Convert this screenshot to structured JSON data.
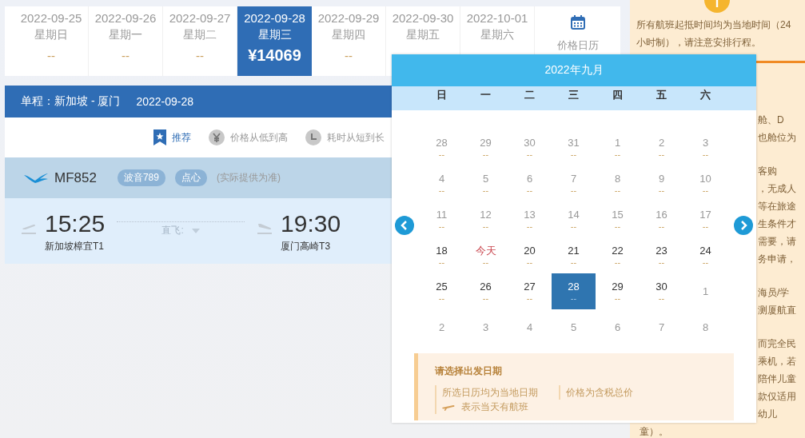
{
  "date_strip": [
    {
      "date": "2022-09-25",
      "weekday": "星期日",
      "price": "--",
      "selected": false
    },
    {
      "date": "2022-09-26",
      "weekday": "星期一",
      "price": "--",
      "selected": false
    },
    {
      "date": "2022-09-27",
      "weekday": "星期二",
      "price": "--",
      "selected": false
    },
    {
      "date": "2022-09-28",
      "weekday": "星期三",
      "price": "¥14069",
      "selected": true
    },
    {
      "date": "2022-09-29",
      "weekday": "星期四",
      "price": "--",
      "selected": false
    },
    {
      "date": "2022-09-30",
      "weekday": "星期五",
      "selected": false
    },
    {
      "date": "2022-10-01",
      "weekday": "星期六",
      "selected": false
    }
  ],
  "calendar_link": {
    "label": "价格日历"
  },
  "route": {
    "label": "单程：新加坡 - 厦门",
    "date": "2022-09-28"
  },
  "sort_options": [
    {
      "kind": "recommend",
      "label": "推荐",
      "selected": true
    },
    {
      "kind": "price",
      "label": "价格从低到高",
      "selected": false
    },
    {
      "kind": "duration",
      "label": "耗时从短到长",
      "selected": false
    }
  ],
  "flight": {
    "number": "MF852",
    "tags": [
      "波音789",
      "点心"
    ],
    "note": "(实际提供为准)",
    "departure": {
      "time": "15:25",
      "airport": "新加坡樟宜T1"
    },
    "stop": "直飞:",
    "arrival": {
      "time": "19:30",
      "airport": "厦门高崎T3"
    }
  },
  "calendar": {
    "title": "2022年九月",
    "weekdays": [
      "日",
      "一",
      "二",
      "三",
      "四",
      "五",
      "六"
    ],
    "weeks": [
      [
        {
          "day": "28",
          "price": "--",
          "kind": "inactive",
          "selected": false
        },
        {
          "day": "29",
          "price": "--",
          "kind": "inactive",
          "selected": false
        },
        {
          "day": "30",
          "price": "--",
          "kind": "inactive",
          "selected": false
        },
        {
          "day": "31",
          "price": "--",
          "kind": "inactive",
          "selected": false
        },
        {
          "day": "1",
          "price": "--",
          "kind": "inactive",
          "selected": false
        },
        {
          "day": "2",
          "price": "--",
          "kind": "inactive",
          "selected": false
        },
        {
          "day": "3",
          "price": "--",
          "kind": "inactive",
          "selected": false
        }
      ],
      [
        {
          "day": "4",
          "price": "--",
          "kind": "inactive",
          "selected": false
        },
        {
          "day": "5",
          "price": "--",
          "kind": "inactive",
          "selected": false
        },
        {
          "day": "6",
          "price": "--",
          "kind": "inactive",
          "selected": false
        },
        {
          "day": "7",
          "price": "--",
          "kind": "inactive",
          "selected": false
        },
        {
          "day": "8",
          "price": "--",
          "kind": "inactive",
          "selected": false
        },
        {
          "day": "9",
          "price": "--",
          "kind": "inactive",
          "selected": false
        },
        {
          "day": "10",
          "price": "--",
          "kind": "inactive",
          "selected": false
        }
      ],
      [
        {
          "day": "11",
          "price": "--",
          "kind": "inactive",
          "selected": false
        },
        {
          "day": "12",
          "price": "--",
          "kind": "inactive",
          "selected": false
        },
        {
          "day": "13",
          "price": "--",
          "kind": "inactive",
          "selected": false
        },
        {
          "day": "14",
          "price": "--",
          "kind": "inactive",
          "selected": false
        },
        {
          "day": "15",
          "price": "--",
          "kind": "inactive",
          "selected": false
        },
        {
          "day": "16",
          "price": "--",
          "kind": "inactive",
          "selected": false
        },
        {
          "day": "17",
          "price": "--",
          "kind": "inactive",
          "selected": false
        }
      ],
      [
        {
          "day": "18",
          "price": "--",
          "kind": "active",
          "selected": false
        },
        {
          "day": "今天",
          "price": "--",
          "kind": "today",
          "selected": false
        },
        {
          "day": "20",
          "price": "--",
          "kind": "active",
          "selected": false
        },
        {
          "day": "21",
          "price": "--",
          "kind": "active",
          "selected": false
        },
        {
          "day": "22",
          "price": "--",
          "kind": "active",
          "selected": false
        },
        {
          "day": "23",
          "price": "--",
          "kind": "active",
          "selected": false
        },
        {
          "day": "24",
          "price": "--",
          "kind": "active",
          "selected": false
        }
      ],
      [
        {
          "day": "25",
          "price": "--",
          "kind": "active",
          "selected": false
        },
        {
          "day": "26",
          "price": "--",
          "kind": "active",
          "selected": false
        },
        {
          "day": "27",
          "price": "--",
          "kind": "active",
          "selected": false
        },
        {
          "day": "28",
          "price": "--",
          "kind": "active",
          "selected": true
        },
        {
          "day": "29",
          "price": "--",
          "kind": "active",
          "selected": false
        },
        {
          "day": "30",
          "price": "--",
          "kind": "active",
          "selected": false
        },
        {
          "day": "1",
          "kind": "inactive",
          "selected": false
        }
      ],
      [
        {
          "day": "2",
          "kind": "inactive",
          "selected": false
        },
        {
          "day": "3",
          "kind": "inactive",
          "selected": false
        },
        {
          "day": "4",
          "kind": "inactive",
          "selected": false
        },
        {
          "day": "5",
          "kind": "inactive",
          "selected": false
        },
        {
          "day": "6",
          "kind": "inactive",
          "selected": false
        },
        {
          "day": "7",
          "kind": "inactive",
          "selected": false
        },
        {
          "day": "8",
          "kind": "inactive",
          "selected": false
        }
      ]
    ],
    "legend": {
      "title": "请选择出发日期",
      "notes": [
        "所选日历均为当地日期",
        "价格为含税总价"
      ],
      "flight_note": "表示当天有航班"
    }
  },
  "sidebar": {
    "notice": "所有航班起抵时间均为当地时间（24小时制），请注意安排行程。",
    "rules": [
      [
        "舱、D",
        "也舱位为"
      ],
      [
        "客购",
        "，无成人",
        "等在旅途",
        "生条件才",
        "需要，请",
        "务申请，"
      ],
      [
        "海员/学",
        "测厦航直"
      ],
      [
        "而完全民",
        "乘机，若",
        "陪伴儿童",
        "款仅适用",
        "幼儿"
      ]
    ],
    "tail": "童）。"
  }
}
